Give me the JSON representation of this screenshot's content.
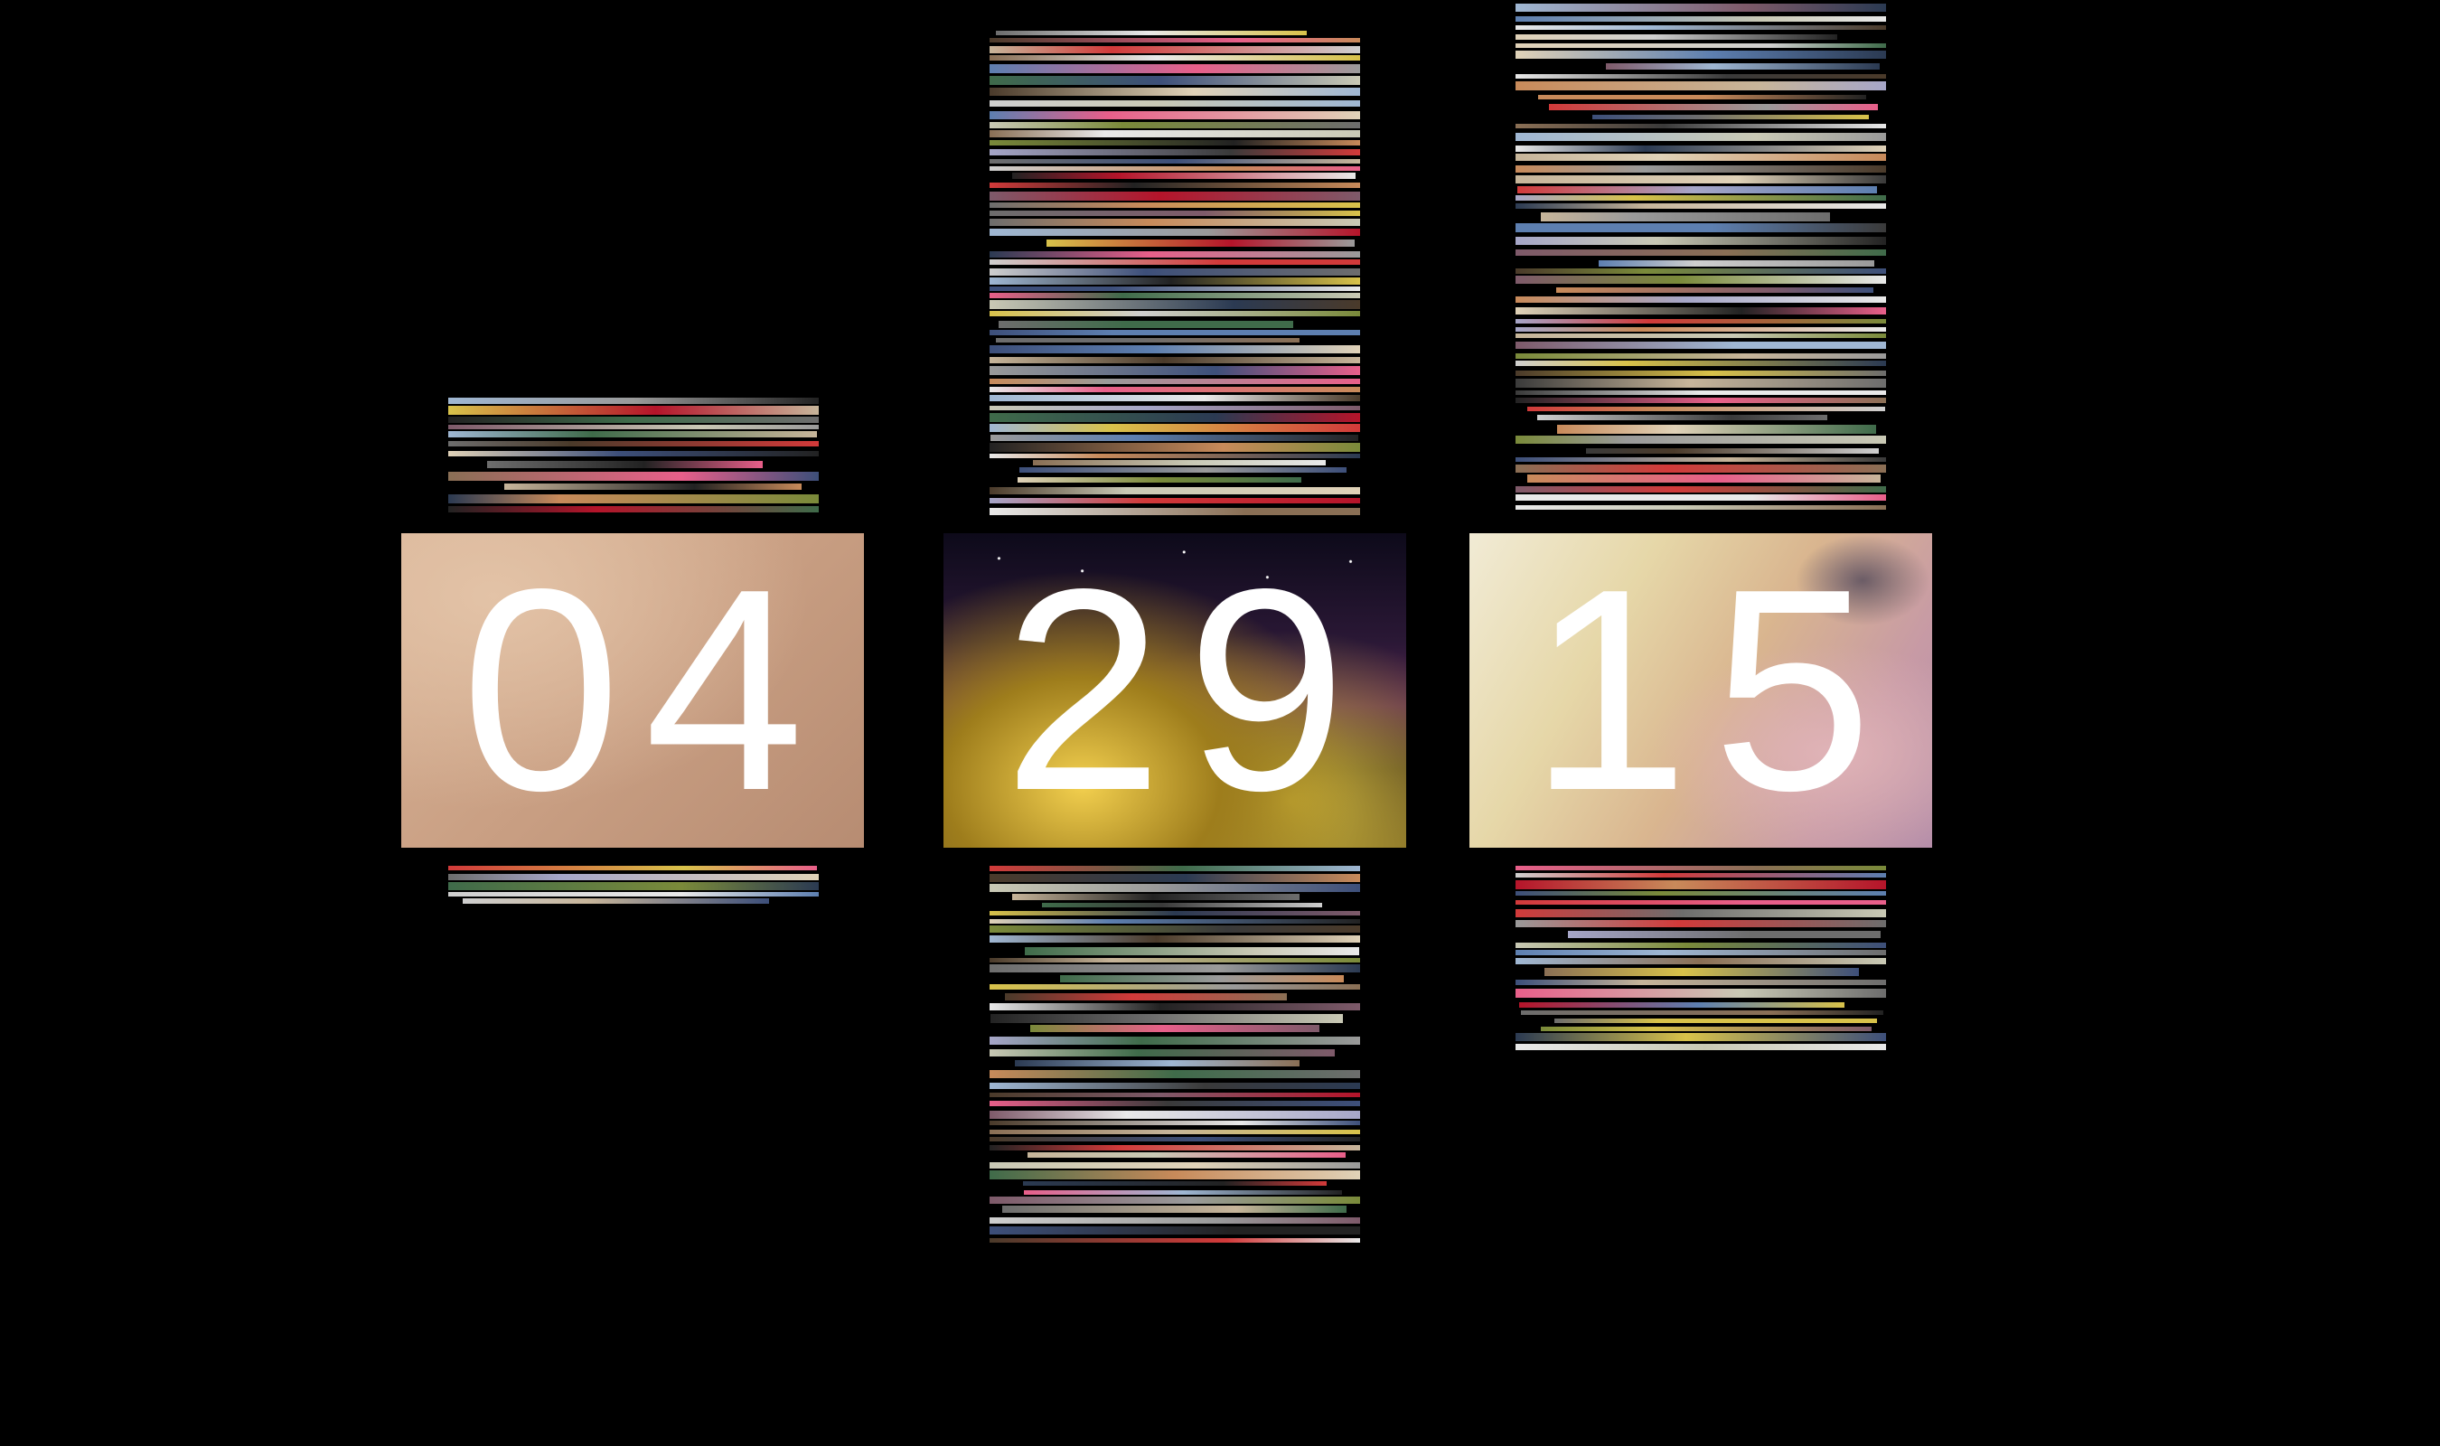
{
  "date_display": {
    "month": "04",
    "day": "29",
    "year": "15"
  },
  "colors": {
    "background": "#000000",
    "digit": "#ffffff"
  }
}
